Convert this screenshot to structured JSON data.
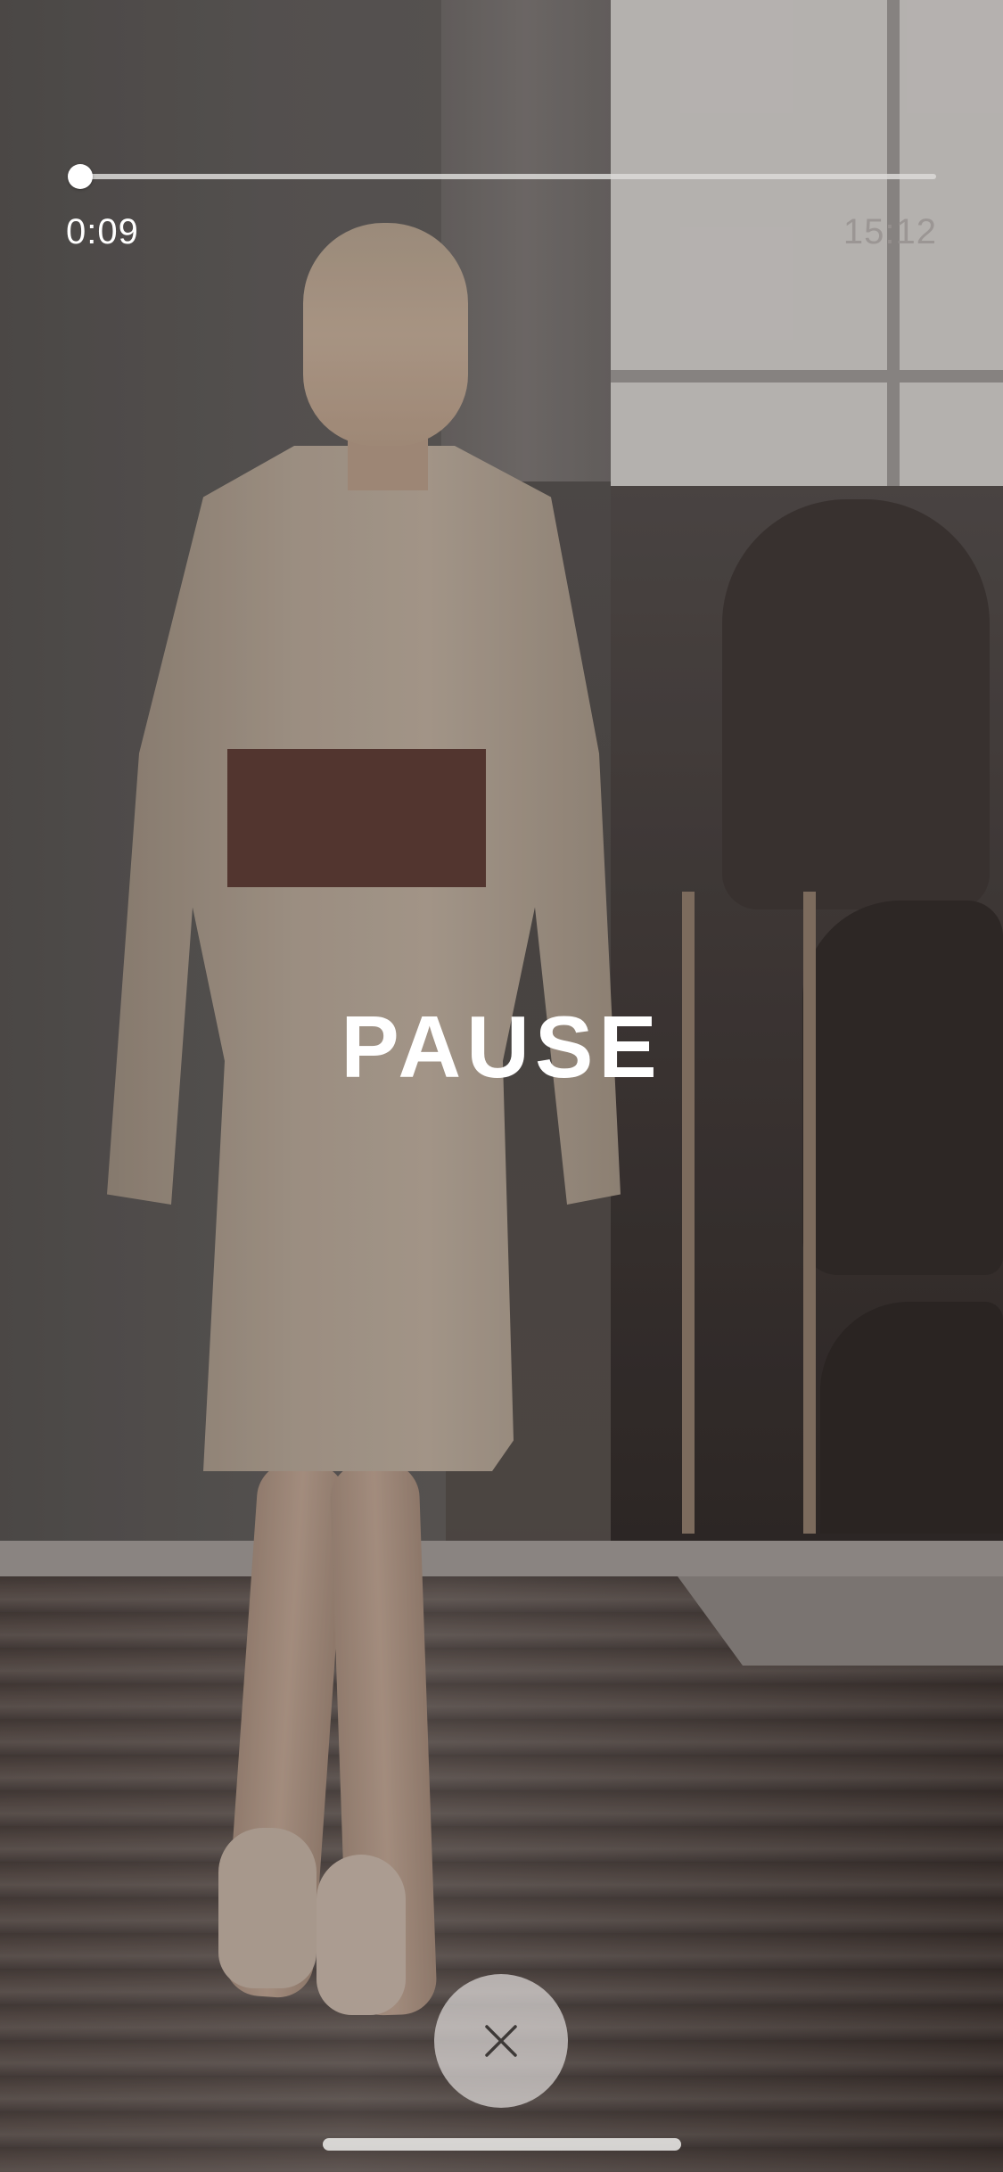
{
  "player": {
    "elapsed_time": "0:09",
    "total_time": "15:12",
    "progress_fraction": 0.0099,
    "state_label": "PAUSE"
  },
  "controls": {
    "close_icon": "close-icon"
  },
  "colors": {
    "overlay_text": "#ffffff",
    "track": "#dcdad8",
    "close_button_bg": "#dedad8"
  }
}
